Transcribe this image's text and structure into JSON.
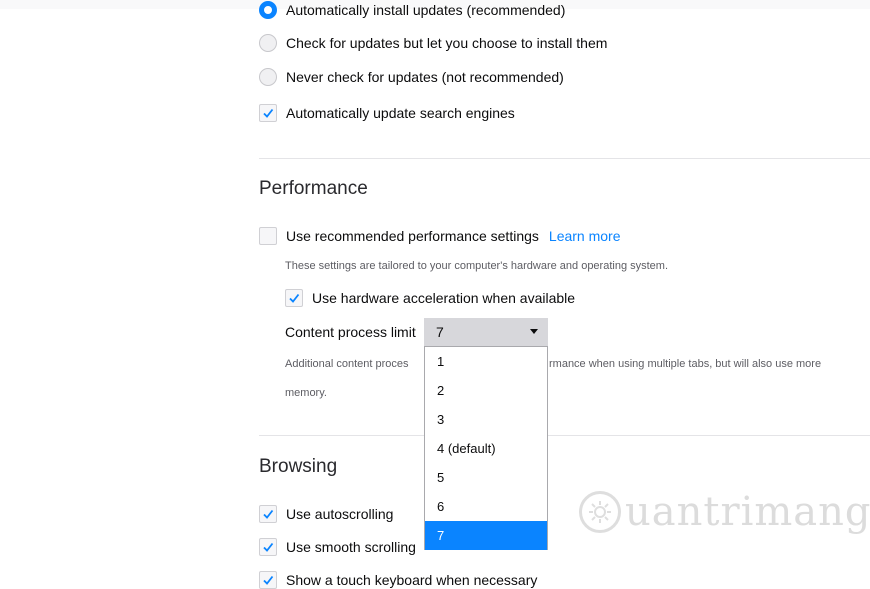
{
  "updates": {
    "options": [
      {
        "label": "Automatically install updates (recommended)"
      },
      {
        "label": "Check for updates but let you choose to install them"
      },
      {
        "label": "Never check for updates (not recommended)"
      }
    ],
    "search_engines_label": "Automatically update search engines"
  },
  "performance": {
    "heading": "Performance",
    "recommended_label": "Use recommended performance settings",
    "learn_more": "Learn more",
    "tailored_note": "These settings are tailored to your computer's hardware and operating system.",
    "hw_accel_label": "Use hardware acceleration when available",
    "process_limit_label": "Content process limit",
    "process_limit_value": "7",
    "process_options": [
      "1",
      "2",
      "3",
      "4 (default)",
      "5",
      "6",
      "7"
    ],
    "note_part1": "Additional content proces",
    "note_part2": "rmance when using multiple tabs, but will also use more",
    "note_part3": "memory."
  },
  "browsing": {
    "heading": "Browsing",
    "autoscroll_label": "Use autoscrolling",
    "smooth_label": "Use smooth scrolling",
    "touch_label": "Show a touch keyboard when necessary"
  },
  "watermark": {
    "text": "uantrimang"
  },
  "colors": {
    "accent": "#0a84ff",
    "check": "#0a84ff"
  }
}
